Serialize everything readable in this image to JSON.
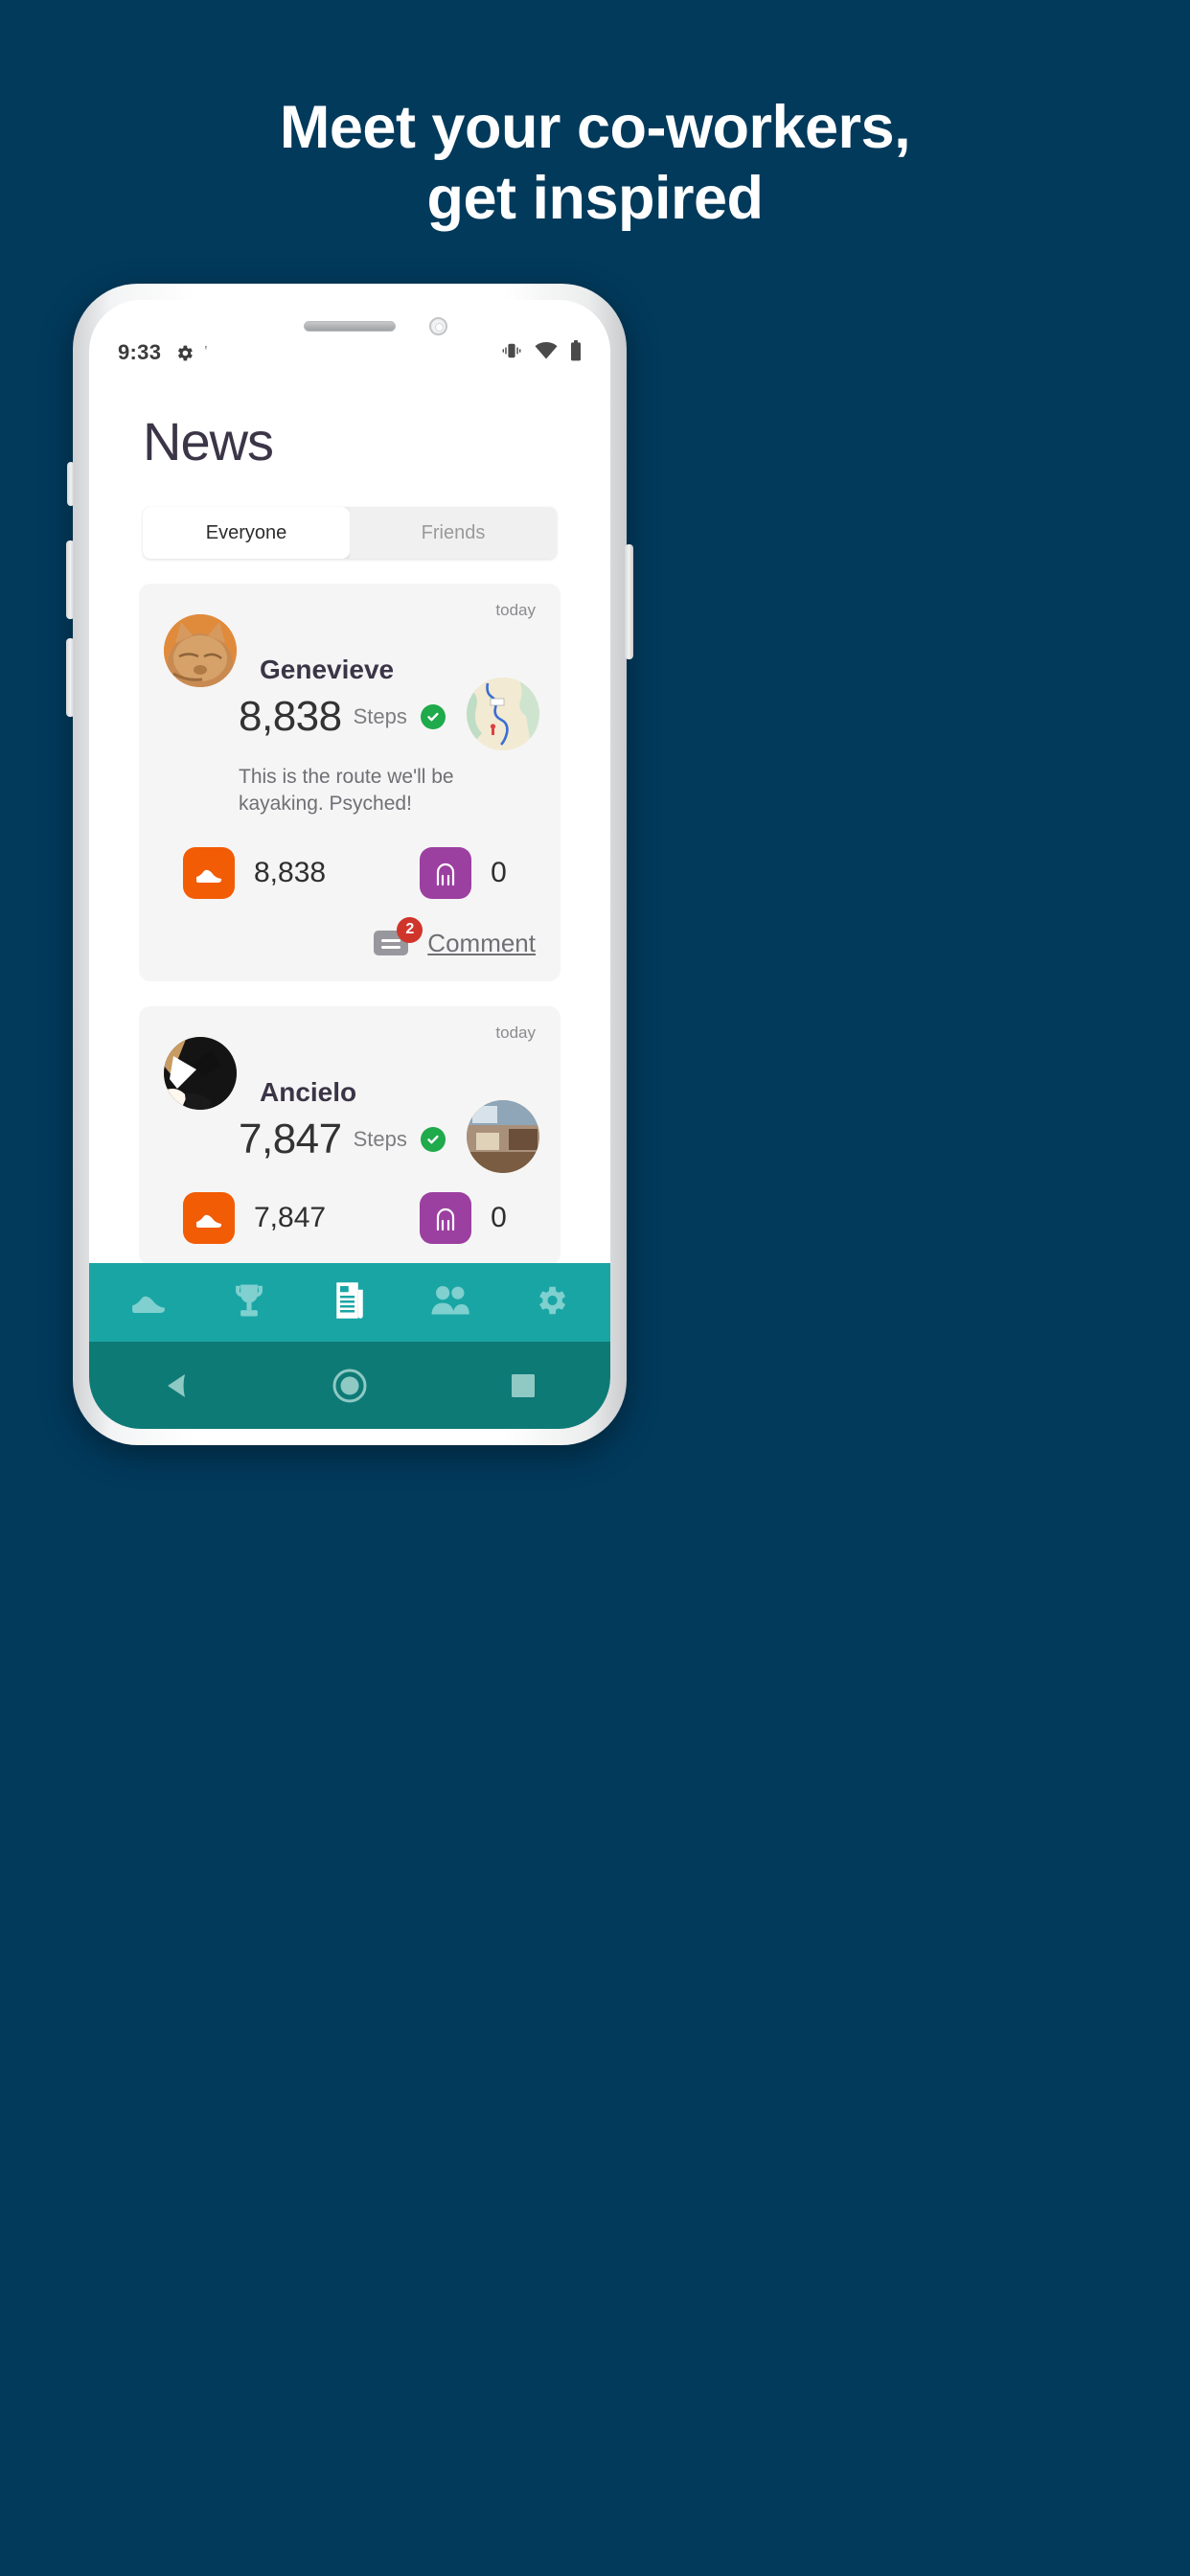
{
  "promo": {
    "headline_line1": "Meet your co-workers,",
    "headline_line2": "get inspired",
    "background_color": "#023A5C",
    "text_color": "#FFFFFF"
  },
  "status_bar": {
    "time": "9:33",
    "gear_icon": "gear-icon",
    "extra_icon": "small-tick-icon",
    "vibrate_icon": "vibrate-icon",
    "wifi_icon": "wifi-icon",
    "battery_icon": "battery-full-icon"
  },
  "app": {
    "page_title": "News",
    "tabs": [
      {
        "label": "Everyone",
        "active": true
      },
      {
        "label": "Friends",
        "active": false
      }
    ],
    "accent_color": "#1AA5A5",
    "posts": [
      {
        "time": "today",
        "user": "Genevieve",
        "avatar": "cat-avatar",
        "steps_value": "8,838",
        "steps_label": "Steps",
        "verified": true,
        "thumbnail": "route-map-thumbnail",
        "text": "This is the route we'll be kayaking. Psyched!",
        "stats": [
          {
            "icon": "shoe-icon",
            "color": "#F25C05",
            "value": "8,838"
          },
          {
            "icon": "jump-rope-icon",
            "color": "#9B3FA0",
            "value": "0"
          }
        ],
        "comment_label": "Comment",
        "comment_count": "2"
      },
      {
        "time": "today",
        "user": "Ancielo",
        "avatar": "dog-avatar",
        "steps_value": "7,847",
        "steps_label": "Steps",
        "verified": true,
        "thumbnail": "room-photo-thumbnail",
        "text": "",
        "stats": [
          {
            "icon": "shoe-icon",
            "color": "#F25C05",
            "value": "7,847"
          },
          {
            "icon": "jump-rope-icon",
            "color": "#9B3FA0",
            "value": "0"
          }
        ],
        "comment_label": "",
        "comment_count": ""
      }
    ],
    "bottom_nav": [
      {
        "icon": "shoe-icon",
        "label": "Activity",
        "active": false
      },
      {
        "icon": "trophy-icon",
        "label": "Challenges",
        "active": false
      },
      {
        "icon": "news-icon",
        "label": "News",
        "active": true
      },
      {
        "icon": "people-icon",
        "label": "Friends",
        "active": false
      },
      {
        "icon": "gear-icon",
        "label": "Settings",
        "active": false
      }
    ]
  },
  "system_nav": {
    "back": "back-triangle-icon",
    "home": "home-circle-icon",
    "recents": "recents-square-icon"
  }
}
